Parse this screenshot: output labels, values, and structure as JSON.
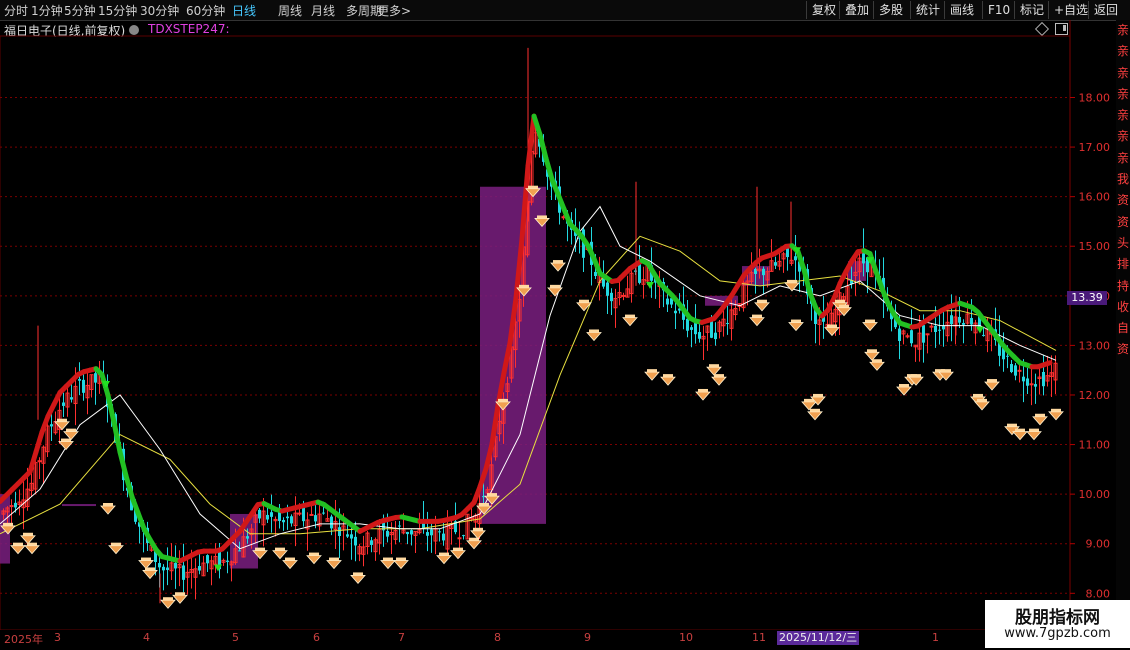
{
  "toolbar": {
    "periods": [
      "分时",
      "1分钟",
      "5分钟",
      "15分钟",
      "30分钟",
      "60分钟",
      "日线",
      "周线",
      "月线",
      "多周期",
      "更多>"
    ],
    "active_period": "日线",
    "right_buttons": [
      "复权",
      "叠加",
      "多股",
      "统计",
      "画线",
      "F10",
      "标记",
      "+自选",
      "返回"
    ]
  },
  "stock": {
    "title": "福日电子(日线,前复权)",
    "indicator": "TDXSTEP247:"
  },
  "price_axis": {
    "labels": [
      "18.00",
      "17.00",
      "16.00",
      "15.00",
      "14.00",
      "13.00",
      "12.00",
      "11.00",
      "10.00",
      "9.00",
      "8.00"
    ],
    "last_price": "13.39"
  },
  "side_strip": "亲亲亲亲亲亲亲我资资头排持收自资",
  "dates": {
    "labels": [
      "2025年",
      "3",
      "4",
      "5",
      "6",
      "7",
      "8",
      "9",
      "10",
      "11",
      "12",
      "1"
    ],
    "highlight": "2025/11/12/三"
  },
  "watermark": {
    "title": "股朋指标网",
    "url": "www.7gpzb.com"
  },
  "colors": {
    "up": "#ff3030",
    "down": "#22d8e0",
    "step_up": "#d01818",
    "step_down": "#22c022",
    "fill": "#7a1f80",
    "ma_short": "#ffffff",
    "ma_long": "#e8e040",
    "marker": "#f0a050"
  },
  "chart_data": {
    "type": "candlestick",
    "ylim": [
      7.3,
      19.2
    ],
    "series": [
      {
        "name": "price_path",
        "values": [
          [
            0,
            9.6
          ],
          [
            15,
            9.9
          ],
          [
            30,
            10.2
          ],
          [
            45,
            11.2
          ],
          [
            60,
            11.8
          ],
          [
            80,
            12.2
          ],
          [
            100,
            12.3
          ],
          [
            110,
            11.6
          ],
          [
            120,
            10.6
          ],
          [
            130,
            9.8
          ],
          [
            145,
            9.0
          ],
          [
            160,
            8.5
          ],
          [
            180,
            8.4
          ],
          [
            200,
            8.6
          ],
          [
            220,
            8.6
          ],
          [
            240,
            9.0
          ],
          [
            260,
            9.6
          ],
          [
            280,
            9.4
          ],
          [
            300,
            9.5
          ],
          [
            320,
            9.6
          ],
          [
            340,
            9.3
          ],
          [
            360,
            9.0
          ],
          [
            380,
            9.2
          ],
          [
            400,
            9.3
          ],
          [
            420,
            9.2
          ],
          [
            440,
            9.2
          ],
          [
            460,
            9.3
          ],
          [
            475,
            9.6
          ],
          [
            490,
            10.5
          ],
          [
            500,
            11.8
          ],
          [
            510,
            12.8
          ],
          [
            518,
            14.0
          ],
          [
            526,
            15.8
          ],
          [
            532,
            17.5
          ],
          [
            540,
            17.0
          ],
          [
            550,
            16.2
          ],
          [
            560,
            15.7
          ],
          [
            570,
            15.2
          ],
          [
            580,
            15.0
          ],
          [
            590,
            14.7
          ],
          [
            600,
            14.2
          ],
          [
            615,
            14.0
          ],
          [
            630,
            14.3
          ],
          [
            645,
            14.5
          ],
          [
            660,
            14.0
          ],
          [
            675,
            13.7
          ],
          [
            690,
            13.3
          ],
          [
            700,
            13.2
          ],
          [
            715,
            13.3
          ],
          [
            730,
            13.7
          ],
          [
            745,
            14.2
          ],
          [
            760,
            14.5
          ],
          [
            775,
            14.6
          ],
          [
            790,
            14.8
          ],
          [
            800,
            14.6
          ],
          [
            810,
            13.8
          ],
          [
            820,
            13.3
          ],
          [
            830,
            13.5
          ],
          [
            840,
            14.0
          ],
          [
            850,
            14.4
          ],
          [
            860,
            14.7
          ],
          [
            870,
            14.6
          ],
          [
            880,
            14.0
          ],
          [
            890,
            13.5
          ],
          [
            900,
            13.2
          ],
          [
            915,
            13.1
          ],
          [
            930,
            13.3
          ],
          [
            945,
            13.5
          ],
          [
            960,
            13.6
          ],
          [
            975,
            13.5
          ],
          [
            990,
            13.1
          ],
          [
            1005,
            12.7
          ],
          [
            1020,
            12.4
          ],
          [
            1035,
            12.3
          ],
          [
            1050,
            12.4
          ],
          [
            1056,
            12.6
          ]
        ]
      },
      {
        "name": "ma_short",
        "values": [
          [
            0,
            9.4
          ],
          [
            40,
            10.1
          ],
          [
            80,
            11.4
          ],
          [
            120,
            12.0
          ],
          [
            160,
            10.9
          ],
          [
            200,
            9.6
          ],
          [
            240,
            8.9
          ],
          [
            280,
            9.2
          ],
          [
            320,
            9.4
          ],
          [
            360,
            9.4
          ],
          [
            400,
            9.3
          ],
          [
            440,
            9.3
          ],
          [
            480,
            9.6
          ],
          [
            520,
            11.2
          ],
          [
            550,
            13.6
          ],
          [
            580,
            15.3
          ],
          [
            600,
            15.8
          ],
          [
            620,
            15.0
          ],
          [
            650,
            14.7
          ],
          [
            700,
            14.0
          ],
          [
            740,
            13.8
          ],
          [
            780,
            14.2
          ],
          [
            820,
            14.0
          ],
          [
            860,
            14.3
          ],
          [
            900,
            13.6
          ],
          [
            940,
            13.4
          ],
          [
            980,
            13.4
          ],
          [
            1020,
            13.0
          ],
          [
            1056,
            12.7
          ]
        ]
      },
      {
        "name": "ma_long",
        "values": [
          [
            0,
            9.2
          ],
          [
            60,
            9.8
          ],
          [
            120,
            11.2
          ],
          [
            170,
            10.7
          ],
          [
            210,
            9.8
          ],
          [
            250,
            9.2
          ],
          [
            300,
            9.2
          ],
          [
            360,
            9.3
          ],
          [
            420,
            9.3
          ],
          [
            480,
            9.5
          ],
          [
            520,
            10.2
          ],
          [
            560,
            12.4
          ],
          [
            600,
            14.3
          ],
          [
            640,
            15.2
          ],
          [
            680,
            14.9
          ],
          [
            720,
            14.3
          ],
          [
            760,
            14.2
          ],
          [
            800,
            14.3
          ],
          [
            840,
            14.4
          ],
          [
            880,
            14.1
          ],
          [
            920,
            13.7
          ],
          [
            960,
            13.7
          ],
          [
            1000,
            13.5
          ],
          [
            1056,
            12.9
          ]
        ]
      }
    ]
  }
}
